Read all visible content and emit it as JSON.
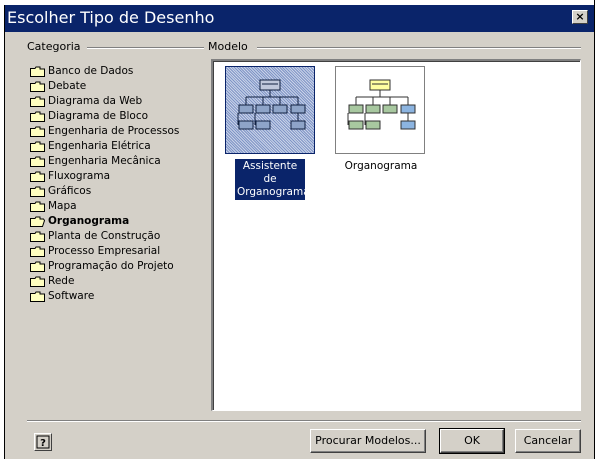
{
  "window": {
    "title": "Escolher Tipo de Desenho",
    "close_glyph": "×"
  },
  "groups": {
    "category_label": "Categoria",
    "model_label": "Modelo"
  },
  "categories": [
    {
      "label": "Banco de Dados"
    },
    {
      "label": "Debate"
    },
    {
      "label": "Diagrama da Web"
    },
    {
      "label": "Diagrama de Bloco"
    },
    {
      "label": "Engenharia de Processos"
    },
    {
      "label": "Engenharia Elétrica"
    },
    {
      "label": "Engenharia Mecânica"
    },
    {
      "label": "Fluxograma"
    },
    {
      "label": "Gráficos"
    },
    {
      "label": "Mapa"
    },
    {
      "label": "Organograma",
      "selected": true
    },
    {
      "label": "Planta de Construção"
    },
    {
      "label": "Processo Empresarial"
    },
    {
      "label": "Programação do Projeto"
    },
    {
      "label": "Rede"
    },
    {
      "label": "Software"
    }
  ],
  "models": [
    {
      "label_line1": "Assistente de",
      "label_line2": "Organograma",
      "selected": true
    },
    {
      "label_line1": "Organograma",
      "label_line2": "",
      "selected": false
    }
  ],
  "buttons": {
    "help_glyph": "?",
    "browse": "Procurar Modelos...",
    "ok": "OK",
    "cancel": "Cancelar"
  },
  "icons": {
    "folder": "folder-icon",
    "help": "help-icon",
    "close": "close-icon"
  },
  "colors": {
    "titlebar": "#0a246a",
    "dialog_bg": "#d4d0c8",
    "folder_fill": "#ffffc0",
    "selection": "#0a246a"
  }
}
